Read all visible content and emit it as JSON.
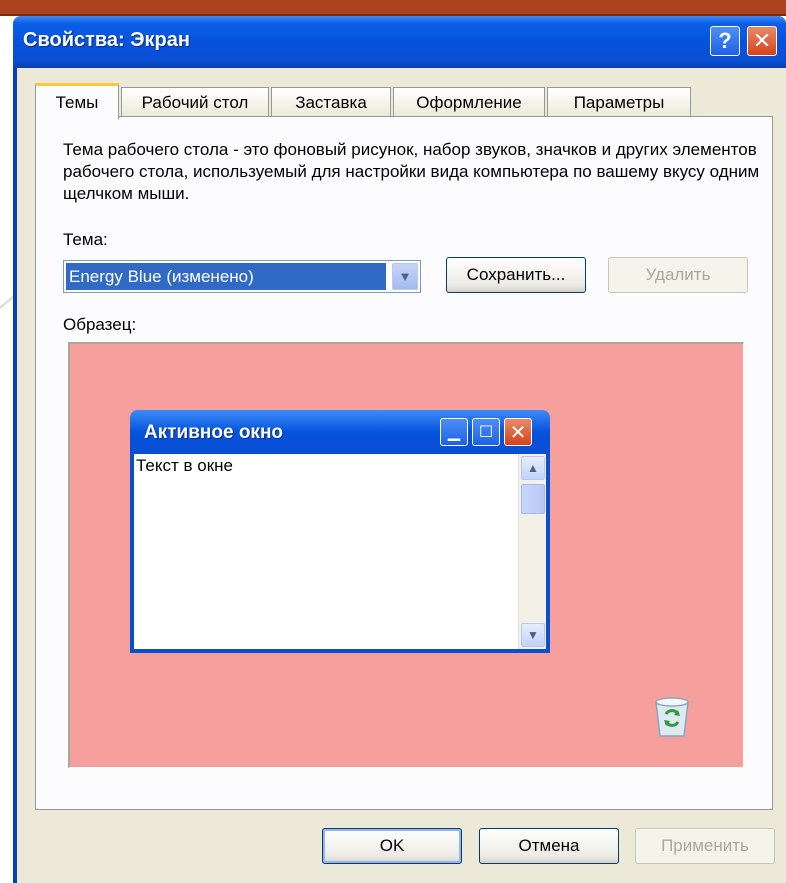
{
  "window": {
    "title": "Свойства: Экран",
    "help_icon": "question-mark-icon",
    "close_icon": "close-icon"
  },
  "tabs": [
    {
      "label": "Темы",
      "active": true
    },
    {
      "label": "Рабочий стол",
      "active": false
    },
    {
      "label": "Заставка",
      "active": false
    },
    {
      "label": "Оформление",
      "active": false
    },
    {
      "label": "Параметры",
      "active": false
    }
  ],
  "themes_panel": {
    "description": "Тема рабочего стола - это фоновый рисунок, набор звуков, значков и других элементов рабочего стола, используемый для настройки вида компьютера по вашему вкусу одним щелчком мыши.",
    "theme_label": "Тема:",
    "theme_value": "Energy Blue (изменено)",
    "save_button": "Сохранить...",
    "delete_button": "Удалить",
    "sample_label": "Образец:"
  },
  "preview": {
    "background_color": "#f5a09c",
    "window_title": "Активное окно",
    "window_text": "Текст в окне",
    "desktop_icon": "recycle-bin-icon"
  },
  "footer": {
    "ok_button": "OK",
    "cancel_button": "Отмена",
    "apply_button": "Применить"
  }
}
